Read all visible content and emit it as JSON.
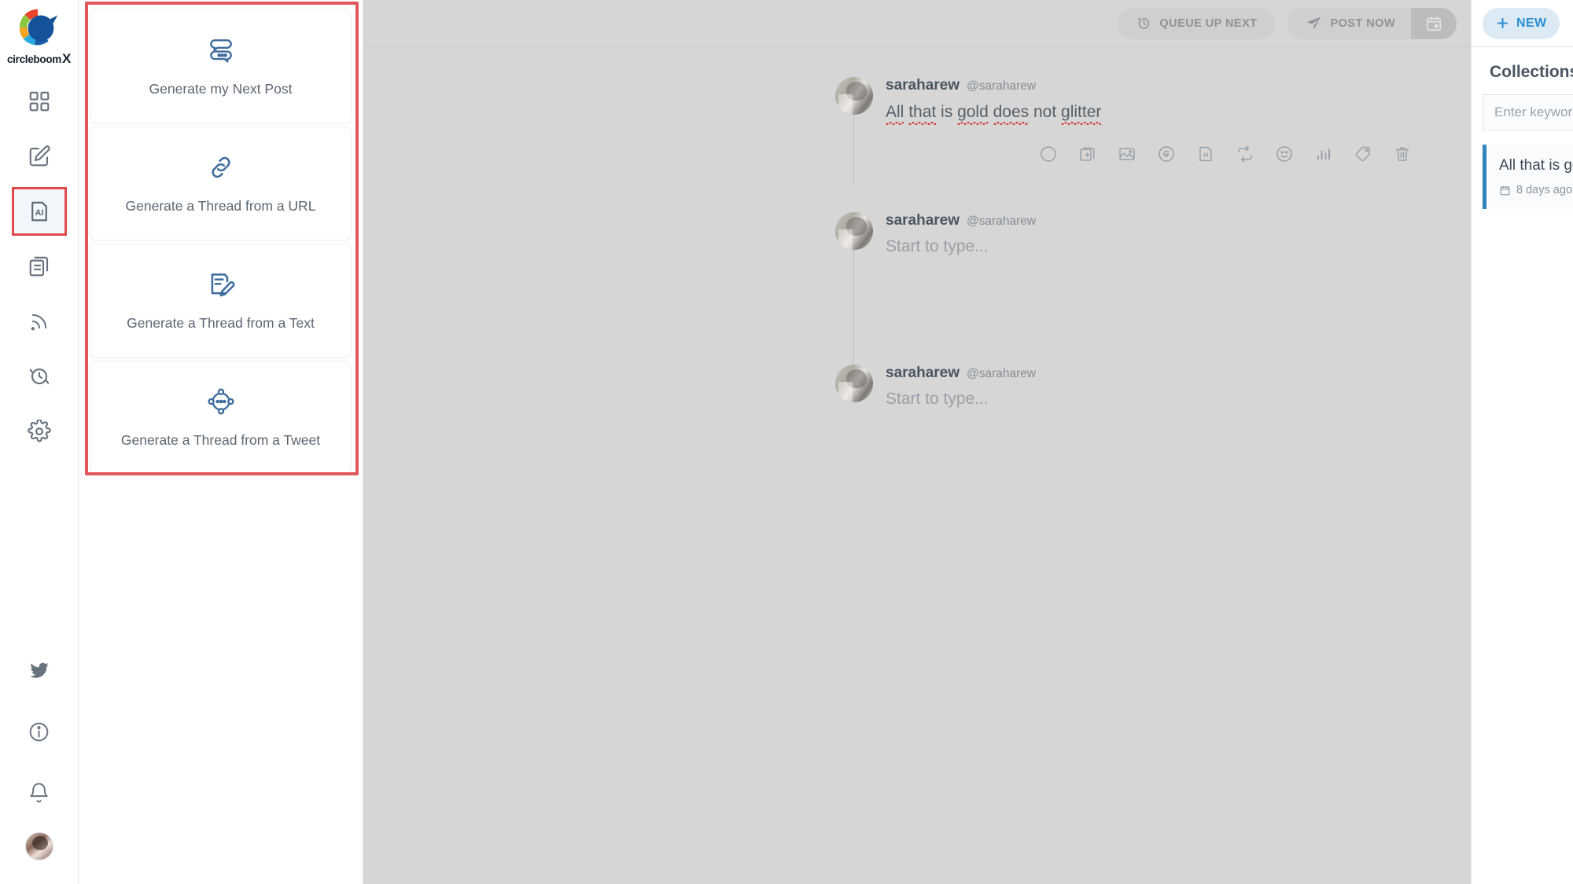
{
  "brand": {
    "name": "circleboom",
    "suffix": "X",
    "logo_icon": "circleboom-logo-icon"
  },
  "sidebar": {
    "items": [
      {
        "id": "dashboard",
        "icon": "dashboard-grid-icon",
        "active": false
      },
      {
        "id": "compose",
        "icon": "compose-pencil-icon",
        "active": false
      },
      {
        "id": "ai",
        "icon": "ai-document-icon",
        "active": true
      },
      {
        "id": "library",
        "icon": "copy-library-icon",
        "active": false
      },
      {
        "id": "rss",
        "icon": "rss-feed-icon",
        "active": false
      },
      {
        "id": "history",
        "icon": "history-clock-icon",
        "active": false
      },
      {
        "id": "settings",
        "icon": "gear-settings-icon",
        "active": false
      }
    ],
    "bottom_items": [
      {
        "id": "twitter",
        "icon": "twitter-bird-icon"
      },
      {
        "id": "info",
        "icon": "info-circle-icon"
      },
      {
        "id": "alerts",
        "icon": "bell-icon"
      }
    ],
    "account_avatar": "user-avatar"
  },
  "ai_panel": {
    "highlight_color": "#e0575c",
    "cards": [
      {
        "label": "Generate my Next Post",
        "icon": "speech-bubbles-icon"
      },
      {
        "label": "Generate a Thread from a URL",
        "icon": "link-chain-icon"
      },
      {
        "label": "Generate a Thread from a Text",
        "icon": "note-pencil-icon"
      },
      {
        "label": "Generate a Thread from a Tweet",
        "icon": "share-nodes-icon"
      }
    ]
  },
  "composer": {
    "toolbar": {
      "queue_label": "QUEUE UP NEXT",
      "queue_icon": "clock-arrow-icon",
      "post_label": "POST NOW",
      "post_icon": "paper-plane-icon",
      "schedule_icon": "calendar-clock-icon"
    },
    "tweets": [
      {
        "name": "saraharew",
        "handle": "@saraharew",
        "text": "All that is gold does not glitter",
        "is_placeholder": false,
        "spellcheck_words": [
          "All",
          "that",
          "gold",
          "does",
          "glitter"
        ]
      },
      {
        "name": "saraharew",
        "handle": "@saraharew",
        "text": "Start to type...",
        "is_placeholder": true
      },
      {
        "name": "saraharew",
        "handle": "@saraharew",
        "text": "Start to type...",
        "is_placeholder": true
      }
    ],
    "tools": [
      {
        "id": "char-counter",
        "icon": "circle-progress-icon"
      },
      {
        "id": "add-post",
        "icon": "add-card-icon"
      },
      {
        "id": "add-image",
        "icon": "image-icon"
      },
      {
        "id": "canva",
        "icon": "canva-icon"
      },
      {
        "id": "ai-assist",
        "icon": "ai-document-icon"
      },
      {
        "id": "retweet",
        "icon": "retweet-icon"
      },
      {
        "id": "emoji",
        "icon": "emoji-smile-icon"
      },
      {
        "id": "poll",
        "icon": "poll-bars-icon"
      },
      {
        "id": "tag",
        "icon": "tag-icon"
      },
      {
        "id": "delete",
        "icon": "trash-icon"
      }
    ]
  },
  "right_panel": {
    "new_button_label": "NEW",
    "new_button_icon": "plus-icon",
    "title": "Collections",
    "title_icon": "collections-bag-icon",
    "search_placeholder": "Enter keyword",
    "items": [
      {
        "title": "All that is gold does not glitter",
        "meta": "8 days ago",
        "meta_icon": "calendar-icon",
        "accent_color": "#2f85bd"
      }
    ]
  }
}
